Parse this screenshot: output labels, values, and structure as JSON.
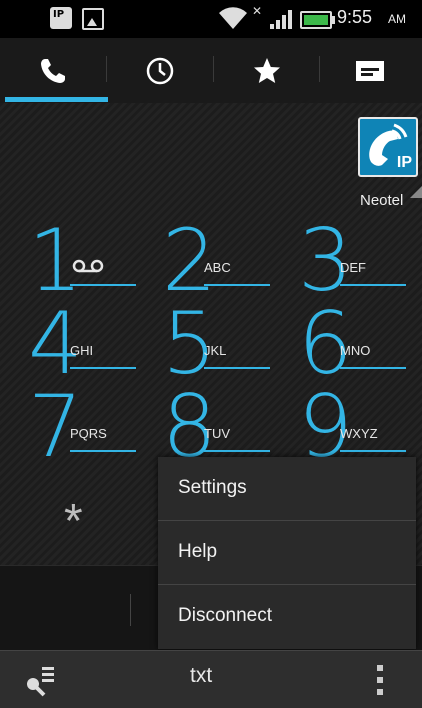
{
  "status_bar": {
    "time": "9:55",
    "ampm": "AM",
    "icons": [
      "note-icon",
      "image-icon",
      "wifi-icon",
      "no-data-icon",
      "signal-icon",
      "battery-icon"
    ],
    "note_label": "IP"
  },
  "tabs": [
    {
      "icon": "phone-icon",
      "selected": true
    },
    {
      "icon": "clock-icon",
      "selected": false
    },
    {
      "icon": "star-icon",
      "selected": false
    },
    {
      "icon": "contacts-card-icon",
      "selected": false
    }
  ],
  "accent_color": "#33b5e5",
  "ip_button": {
    "label": "IP",
    "color": "#0f84b6"
  },
  "provider": "Neotel",
  "keypad": [
    {
      "digit": "1",
      "letters": "",
      "icon": "voicemail-icon"
    },
    {
      "digit": "2",
      "letters": "ABC"
    },
    {
      "digit": "3",
      "letters": "DEF"
    },
    {
      "digit": "4",
      "letters": "GHI"
    },
    {
      "digit": "5",
      "letters": "JKL"
    },
    {
      "digit": "6",
      "letters": "MNO"
    },
    {
      "digit": "7",
      "letters": "PQRS"
    },
    {
      "digit": "8",
      "letters": "TUV"
    },
    {
      "digit": "9",
      "letters": "WXYZ"
    },
    {
      "digit": "*",
      "letters": ""
    }
  ],
  "menu": {
    "items": [
      "Settings",
      "Help",
      "Disconnect"
    ]
  },
  "bottom_bar": {
    "txt_label": "txt",
    "icons": [
      "contact-search-icon",
      "overflow-menu-icon"
    ]
  }
}
